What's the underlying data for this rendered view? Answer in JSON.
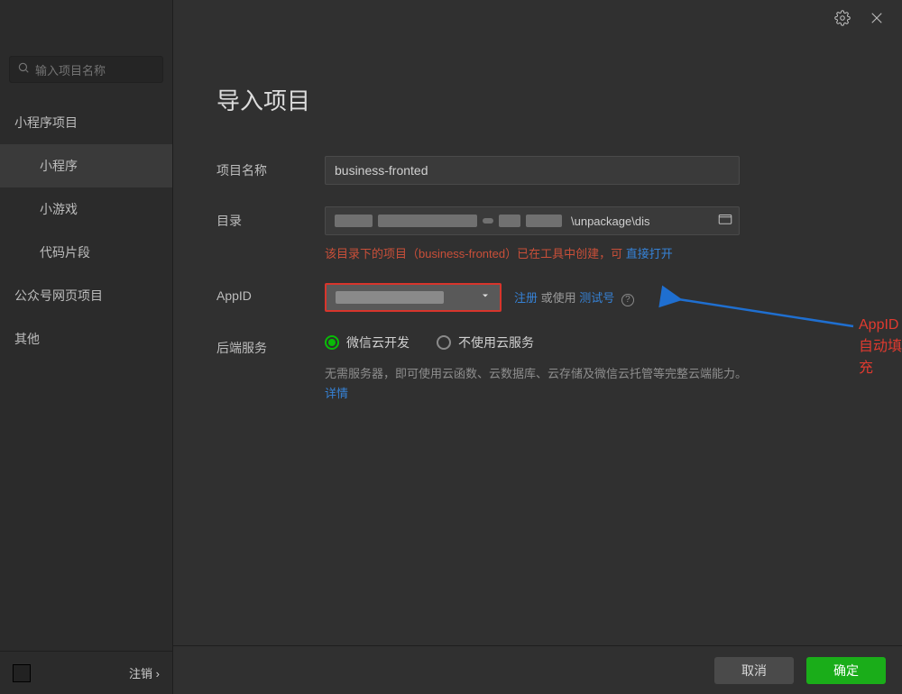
{
  "search": {
    "placeholder": "输入项目名称"
  },
  "nav": {
    "group_miniprogram": "小程序项目",
    "item_miniapp": "小程序",
    "item_minigame": "小游戏",
    "item_snippet": "代码片段",
    "group_webpage": "公众号网页项目",
    "group_other": "其他"
  },
  "sidebar_footer": {
    "logout": "注销  ›"
  },
  "page": {
    "title": "导入项目",
    "labels": {
      "project_name": "项目名称",
      "directory": "目录",
      "appid": "AppID",
      "backend": "后端服务"
    },
    "project_name_value": "business-fronted",
    "path_tail": "\\unpackage\\dis",
    "warn_prefix": "该目录下的项目（business-fronted）已在工具中创建，可 ",
    "warn_link": "直接打开",
    "appid_row": {
      "register": "注册",
      "or_use": " 或使用 ",
      "test_id": "测试号",
      "help": "?"
    },
    "backend_options": {
      "cloud": "微信云开发",
      "nocloud": "不使用云服务"
    },
    "backend_desc": "无需服务器，即可使用云函数、云数据库、云存储及微信云托管等完整云端能力。",
    "backend_detail": "详情"
  },
  "footer": {
    "cancel": "取消",
    "confirm": "确定"
  },
  "annotation": {
    "appid_autofill": "AppID自动填充"
  }
}
